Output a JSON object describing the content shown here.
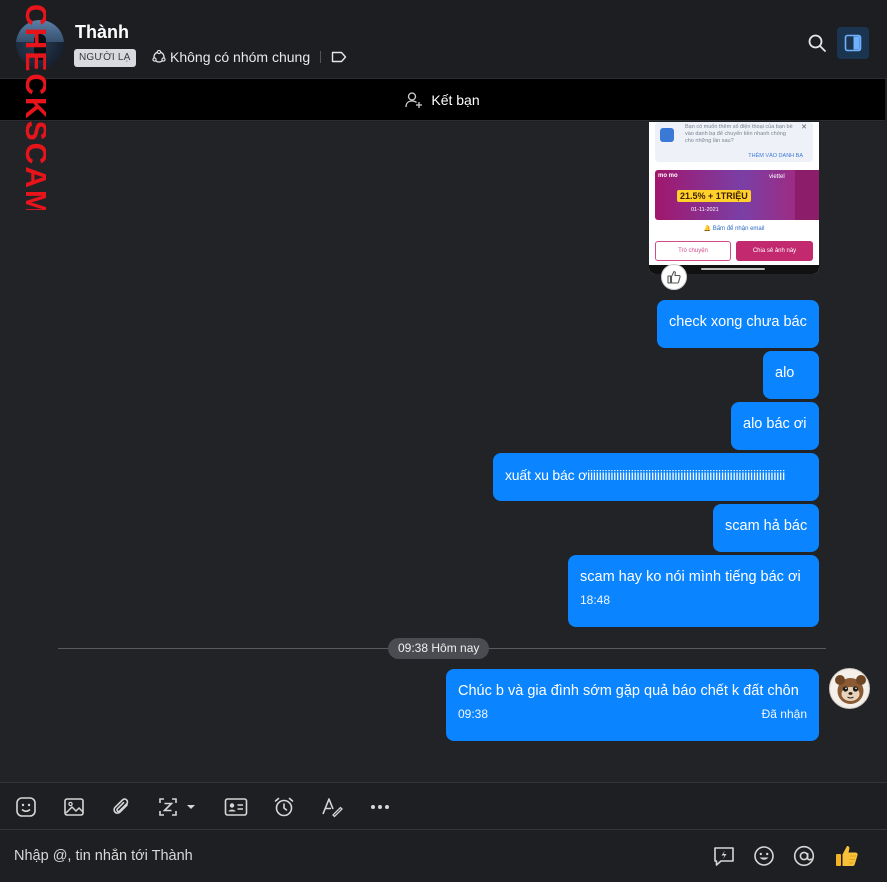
{
  "header": {
    "contact_name": "Thành",
    "stranger_tag": "NGƯỜI LẠ",
    "group_info": "Không có nhóm chung"
  },
  "friend_bar": {
    "label": "Kết bạn"
  },
  "watermark": {
    "text": "CHECKSCAM.INFO"
  },
  "screenshot_message": {
    "notice_text": "Bạn có muốn thêm số điện thoại của bạn bè vào danh bạ để chuyển tiền nhanh chóng cho những lần sau?",
    "notice_link": "THÊM VÀO DANH BẠ",
    "brand_left": "mo mo",
    "brand_right": "viettel",
    "promo": "21.5% + 1TRIỆU",
    "promo_date": "01-11-2021",
    "email_hint": "Bấm để nhận email",
    "btn_chat": "Trò chuyện",
    "btn_share": "Chia sẻ ảnh này"
  },
  "messages": [
    {
      "text": "check xong chưa bác"
    },
    {
      "text": "alo "
    },
    {
      "text": "alo bác ơi"
    },
    {
      "text": "xuất xu bác ơiiiiiiiiiiiiiiiiiiiiiiiiiiiiiiiiiiiiiiiiiiiiiiiiiiiiiiiiiiiiiiiiiiii"
    },
    {
      "text": "scam hả bác"
    },
    {
      "text": "scam hay ko nói mình tiếng bác ơi",
      "time": "18:48"
    }
  ],
  "divider": {
    "label": "09:38 Hôm nay"
  },
  "last_message": {
    "text": "Chúc b và gia đình sớm gặp quả báo chết k đất chôn",
    "time": "09:38",
    "status": "Đã nhận"
  },
  "composer": {
    "placeholder": "Nhập @, tin nhắn tới Thành"
  },
  "colors": {
    "bubble": "#0a84ff",
    "background": "#222326",
    "header": "#1d1e22",
    "watermark": "#e8141b"
  }
}
